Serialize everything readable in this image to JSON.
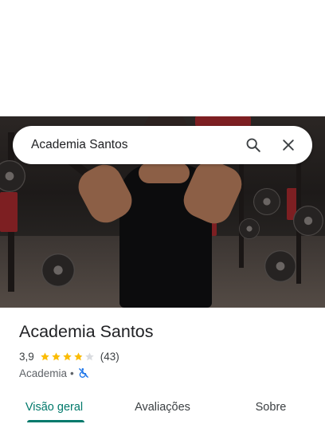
{
  "search": {
    "query": "Academia Santos",
    "icons": {
      "search": "search-icon",
      "close": "close-icon"
    }
  },
  "place": {
    "name": "Academia Santos",
    "rating": "3,9",
    "rating_value": 3.9,
    "stars_max": 5,
    "review_count": "(43)",
    "category": "Academia",
    "separator": "•",
    "accessibility_icon": "not-wheelchair-accessible-icon"
  },
  "tabs": [
    {
      "label": "Visão geral",
      "active": true
    },
    {
      "label": "Avaliações",
      "active": false
    },
    {
      "label": "Sobre",
      "active": false
    }
  ],
  "colors": {
    "accent": "#00796b",
    "star": "#fbbc04",
    "star_empty": "#dadce0",
    "access_icon": "#1a73e8"
  }
}
